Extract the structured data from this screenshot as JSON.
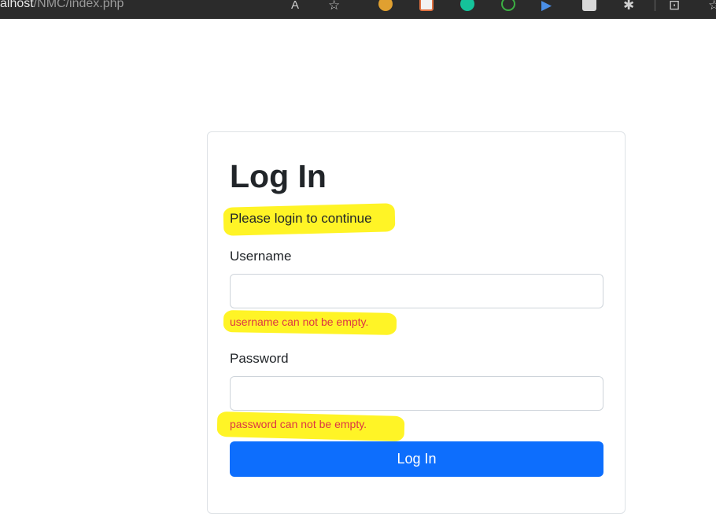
{
  "browser": {
    "url_host": "alhost",
    "url_path": "/NMC/index.php"
  },
  "login": {
    "title": "Log In",
    "subtitle": "Please login to continue",
    "username_label": "Username",
    "username_value": "",
    "username_error": "username can not be empty.",
    "password_label": "Password",
    "password_value": "",
    "password_error": "password can not be empty.",
    "submit_label": "Log In"
  },
  "colors": {
    "primary": "#0d6efd",
    "error": "#dc3545",
    "highlight": "#fff200"
  }
}
